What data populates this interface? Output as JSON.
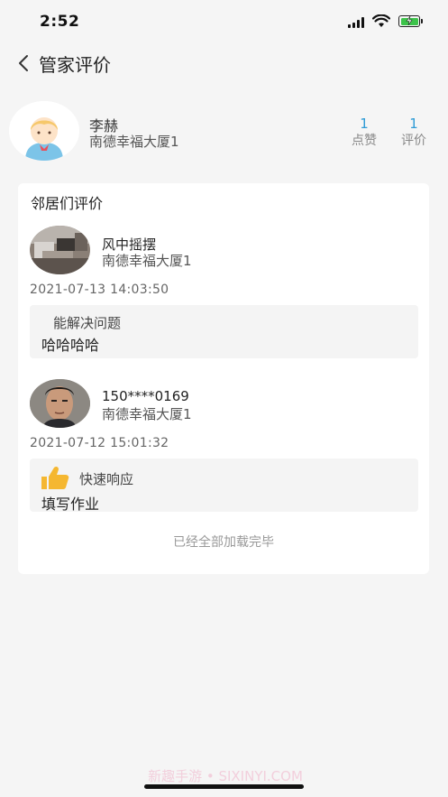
{
  "status_bar": {
    "time": "2:52"
  },
  "nav": {
    "title": "管家评价"
  },
  "manager": {
    "name": "李赫",
    "address": "南德幸福大厦1",
    "likes_count": "1",
    "likes_label": "点赞",
    "reviews_count": "1",
    "reviews_label": "评价"
  },
  "reviews_section": {
    "title": "邻居们评价",
    "items": [
      {
        "name": "风中摇摆",
        "address": "南德幸福大厦1",
        "time": "2021-07-13 14:03:50",
        "tag": "能解决问题",
        "content": "哈哈哈哈"
      },
      {
        "name": "150****0169",
        "address": "南德幸福大厦1",
        "time": "2021-07-12 15:01:32",
        "tag": "快速响应",
        "tag_icon": "thumbs-up-icon",
        "content": "填写作业"
      }
    ],
    "end_text": "已经全部加载完毕"
  },
  "watermark": "新趣手游 • SIXINYI.COM",
  "colors": {
    "accent": "#2f9bd6",
    "background": "#f5f5f5",
    "battery": "#3cc34a",
    "thumb": "#f5b731"
  }
}
